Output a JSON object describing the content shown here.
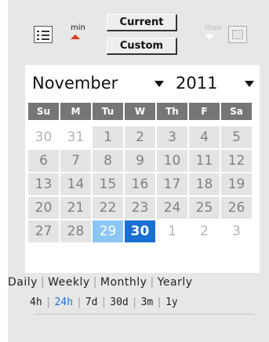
{
  "toolbar": {
    "min_label": "min",
    "max_label": "max",
    "current_label": "Current",
    "custom_label": "Custom",
    "list_icon": "list-icon",
    "maximize_icon": "window-icon"
  },
  "calendar": {
    "month": "November",
    "year": "2011",
    "weekdays": [
      "Su",
      "M",
      "Tu",
      "W",
      "Th",
      "F",
      "Sa"
    ],
    "weeks": [
      [
        {
          "d": "30",
          "t": "other"
        },
        {
          "d": "31",
          "t": "other"
        },
        {
          "d": "1",
          "t": "in"
        },
        {
          "d": "2",
          "t": "in"
        },
        {
          "d": "3",
          "t": "in"
        },
        {
          "d": "4",
          "t": "in"
        },
        {
          "d": "5",
          "t": "in"
        }
      ],
      [
        {
          "d": "6",
          "t": "in"
        },
        {
          "d": "7",
          "t": "in"
        },
        {
          "d": "8",
          "t": "in"
        },
        {
          "d": "9",
          "t": "in"
        },
        {
          "d": "10",
          "t": "in"
        },
        {
          "d": "11",
          "t": "in"
        },
        {
          "d": "12",
          "t": "in"
        }
      ],
      [
        {
          "d": "13",
          "t": "in"
        },
        {
          "d": "14",
          "t": "in"
        },
        {
          "d": "15",
          "t": "in"
        },
        {
          "d": "16",
          "t": "in"
        },
        {
          "d": "17",
          "t": "in"
        },
        {
          "d": "18",
          "t": "in"
        },
        {
          "d": "19",
          "t": "in"
        }
      ],
      [
        {
          "d": "20",
          "t": "in"
        },
        {
          "d": "21",
          "t": "in"
        },
        {
          "d": "22",
          "t": "in"
        },
        {
          "d": "23",
          "t": "in"
        },
        {
          "d": "24",
          "t": "in"
        },
        {
          "d": "25",
          "t": "in"
        },
        {
          "d": "26",
          "t": "in"
        }
      ],
      [
        {
          "d": "27",
          "t": "in"
        },
        {
          "d": "28",
          "t": "in"
        },
        {
          "d": "29",
          "t": "sel-a"
        },
        {
          "d": "30",
          "t": "sel-b"
        },
        {
          "d": "1",
          "t": "other"
        },
        {
          "d": "2",
          "t": "other"
        },
        {
          "d": "3",
          "t": "other"
        }
      ]
    ]
  },
  "periods": [
    "Daily",
    "Weekly",
    "Monthly",
    "Yearly"
  ],
  "spans": [
    {
      "label": "4h",
      "active": false
    },
    {
      "label": "24h",
      "active": true
    },
    {
      "label": "7d",
      "active": false
    },
    {
      "label": "30d",
      "active": false
    },
    {
      "label": "3m",
      "active": false
    },
    {
      "label": "1y",
      "active": false
    }
  ],
  "colors": {
    "accent": "#1a6fd3",
    "accent_light": "#8cc6f5",
    "header": "#767676",
    "min_arrow": "#d93a1a"
  }
}
